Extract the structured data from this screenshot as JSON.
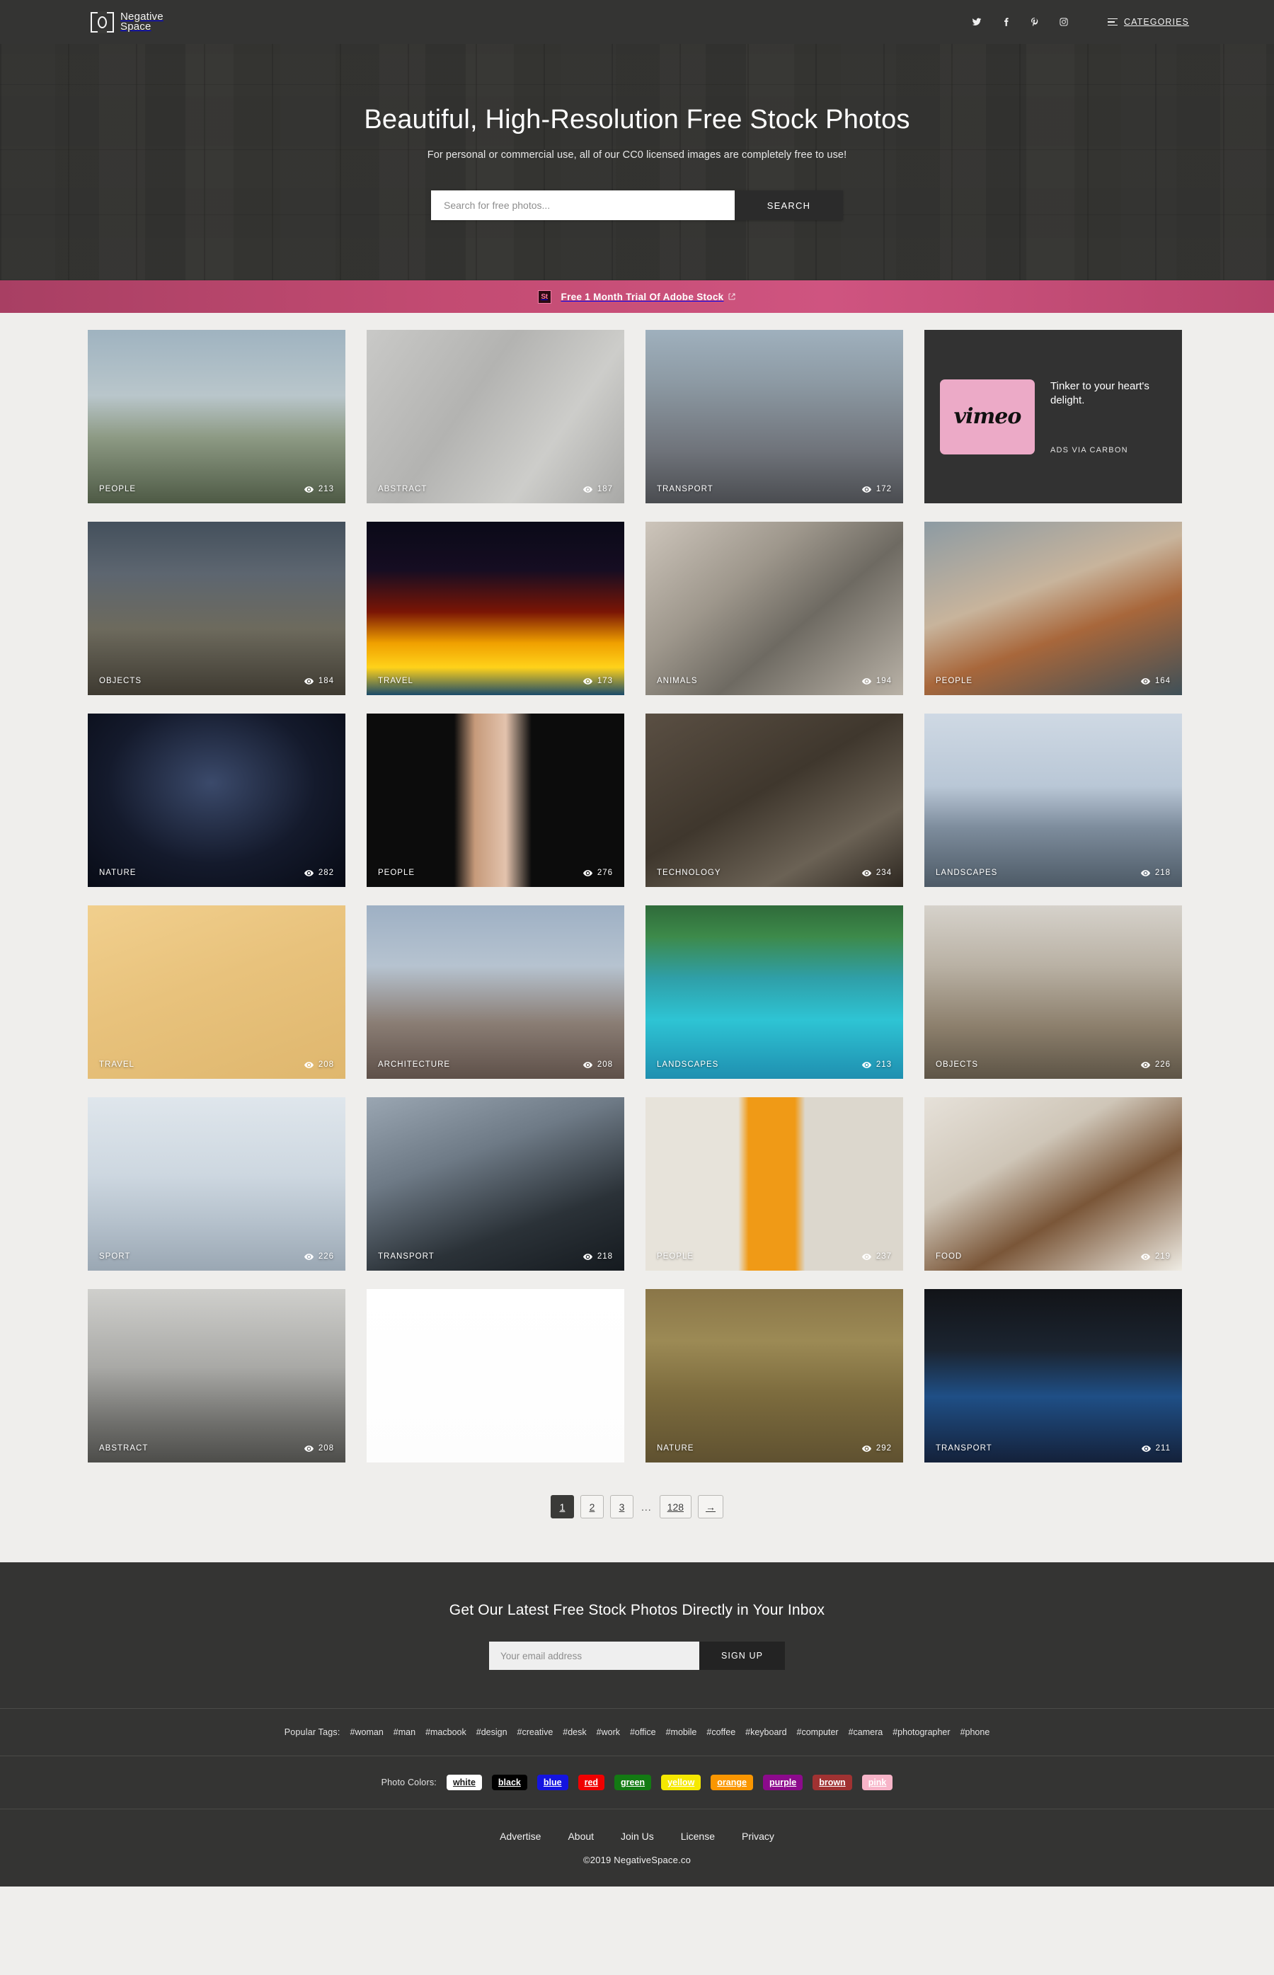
{
  "header": {
    "logo_line1": "Negative",
    "logo_line2": "Space",
    "social": [
      {
        "name": "twitter-icon",
        "label": "Twitter"
      },
      {
        "name": "facebook-icon",
        "label": "Facebook"
      },
      {
        "name": "pinterest-icon",
        "label": "Pinterest"
      },
      {
        "name": "instagram-icon",
        "label": "Instagram"
      }
    ],
    "categories_label": "CATEGORIES"
  },
  "hero": {
    "title": "Beautiful, High-Resolution Free Stock Photos",
    "subtitle": "For personal or commercial use, all of our CC0 licensed images are completely free to use!",
    "search_placeholder": "Search for free photos...",
    "search_value": "",
    "search_button": "SEARCH"
  },
  "promo": {
    "badge": "St",
    "text": "Free 1 Month Trial Of Adobe Stock",
    "background_start": "#a83f63",
    "background_end": "#cf5480"
  },
  "gallery": {
    "cards": [
      {
        "category": "PEOPLE",
        "views": "213",
        "photo": "photographer-palm-trees"
      },
      {
        "category": "ABSTRACT",
        "views": "187",
        "photo": "grey-stone-texture"
      },
      {
        "category": "TRANSPORT",
        "views": "172",
        "photo": "highway-traffic"
      },
      {
        "category": "OBJECTS",
        "views": "184",
        "photo": "canoe-lake-dusk"
      },
      {
        "category": "TRAVEL",
        "views": "173",
        "photo": "night-light-trails"
      },
      {
        "category": "ANIMALS",
        "views": "194",
        "photo": "tabby-cat-portrait"
      },
      {
        "category": "PEOPLE",
        "views": "164",
        "photo": "man-pouring-coffee"
      },
      {
        "category": "NATURE",
        "views": "282",
        "photo": "milky-way-stars"
      },
      {
        "category": "PEOPLE",
        "views": "276",
        "photo": "two-arms-hands"
      },
      {
        "category": "TECHNOLOGY",
        "views": "234",
        "photo": "smartwatch-notebook"
      },
      {
        "category": "LANDSCAPES",
        "views": "218",
        "photo": "snowy-mountain-peak"
      },
      {
        "category": "TRAVEL",
        "views": "208",
        "photo": "vacation-flatlay"
      },
      {
        "category": "ARCHITECTURE",
        "views": "208",
        "photo": "eiffel-tower"
      },
      {
        "category": "LANDSCAPES",
        "views": "213",
        "photo": "tropical-coastline"
      },
      {
        "category": "OBJECTS",
        "views": "226",
        "photo": "stacked-wood-logs"
      },
      {
        "category": "SPORT",
        "views": "226",
        "photo": "winter-bridge-runner"
      },
      {
        "category": "TRANSPORT",
        "views": "218",
        "photo": "car-open-door"
      },
      {
        "category": "PEOPLE",
        "views": "237",
        "photo": "person-orange-wall"
      },
      {
        "category": "FOOD",
        "views": "219",
        "photo": "hot-chocolate-glasses"
      },
      {
        "category": "ABSTRACT",
        "views": "208",
        "photo": "grey-gravel-texture"
      },
      {
        "category": "",
        "views": "",
        "photo": "red-shoes-wallet"
      },
      {
        "category": "NATURE",
        "views": "292",
        "photo": "autumn-forest"
      },
      {
        "category": "TRANSPORT",
        "views": "211",
        "photo": "blue-train-seats"
      }
    ],
    "ad": {
      "logo_text": "vimeo",
      "headline": "Tinker to your heart's delight.",
      "via": "ADS VIA CARBON",
      "logo_bg": "#ecaac7"
    }
  },
  "pagination": {
    "pages": [
      "1",
      "2",
      "3"
    ],
    "active": "1",
    "ellipsis": "...",
    "last_page": "128",
    "next_label": "→"
  },
  "newsletter": {
    "title": "Get Our Latest Free Stock Photos Directly in Your Inbox",
    "email_placeholder": "Your email address",
    "email_value": "",
    "button": "SIGN UP"
  },
  "footer": {
    "tags_label": "Popular Tags:",
    "tags": [
      "#woman",
      "#man",
      "#macbook",
      "#design",
      "#creative",
      "#desk",
      "#work",
      "#office",
      "#mobile",
      "#coffee",
      "#keyboard",
      "#computer",
      "#camera",
      "#photographer",
      "#phone"
    ],
    "colors_label": "Photo Colors:",
    "colors": [
      {
        "label": "white",
        "bg": "#ffffff",
        "fg": "#1a1a1a"
      },
      {
        "label": "black",
        "bg": "#000000",
        "fg": "#ffffff"
      },
      {
        "label": "blue",
        "bg": "#1414e0",
        "fg": "#ffffff"
      },
      {
        "label": "red",
        "bg": "#f00000",
        "fg": "#ffffff"
      },
      {
        "label": "green",
        "bg": "#137a13",
        "fg": "#ffffff"
      },
      {
        "label": "yellow",
        "bg": "#f5e800",
        "fg": "#ffffff"
      },
      {
        "label": "orange",
        "bg": "#fa9600",
        "fg": "#ffffff"
      },
      {
        "label": "purple",
        "bg": "#8c0a8c",
        "fg": "#ffffff"
      },
      {
        "label": "brown",
        "bg": "#a03232",
        "fg": "#ffffff"
      },
      {
        "label": "pink",
        "bg": "#f7b4c8",
        "fg": "#ffffff"
      }
    ],
    "links": [
      "Advertise",
      "About",
      "Join Us",
      "License",
      "Privacy"
    ],
    "copyright": "©2019 NegativeSpace.co"
  }
}
